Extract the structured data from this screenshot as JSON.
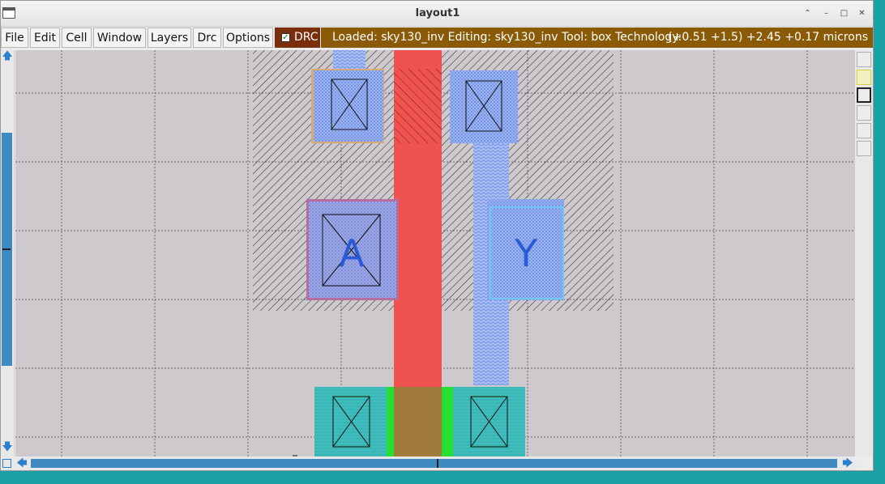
{
  "window": {
    "title": "layout1",
    "controls": [
      "⌃",
      "–",
      "□",
      "✕"
    ]
  },
  "menu": {
    "items": [
      "File",
      "Edit",
      "Cell",
      "Window",
      "Layers",
      "Drc",
      "Options"
    ]
  },
  "drc": {
    "label": "DRC",
    "checked": true
  },
  "status": {
    "text": "Loaded: sky130_inv Editing: sky130_inv Tool: box  Technology:",
    "coords": "(+0.51 +1.5) +2.45 +0.17 microns"
  },
  "layout": {
    "labels": [
      "A",
      "Y"
    ]
  },
  "colors": {
    "poly": "#ef5350",
    "metal": "#7d9ff0",
    "diffusion": "#3fc8a0",
    "implant": "#24e030",
    "status_bg": "#8a5a07",
    "drc_bg": "#7a2e0b",
    "scroll": "#3f8ac2",
    "canvas_bg": "#cdc9cd"
  }
}
